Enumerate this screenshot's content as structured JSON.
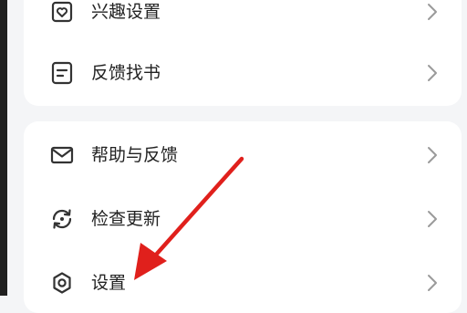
{
  "menu": {
    "group1": [
      {
        "label": "兴趣设置",
        "icon": "heart-square-icon"
      },
      {
        "label": "反馈找书",
        "icon": "document-icon"
      }
    ],
    "group2": [
      {
        "label": "帮助与反馈",
        "icon": "mail-icon"
      },
      {
        "label": "检查更新",
        "icon": "refresh-icon"
      },
      {
        "label": "设置",
        "icon": "gear-icon"
      }
    ]
  },
  "colors": {
    "background": "#f4f5f7",
    "card": "#ffffff",
    "text": "#222222",
    "icon": "#333333",
    "chevron": "#9a9a9a",
    "annotation_arrow": "#e0201c"
  }
}
